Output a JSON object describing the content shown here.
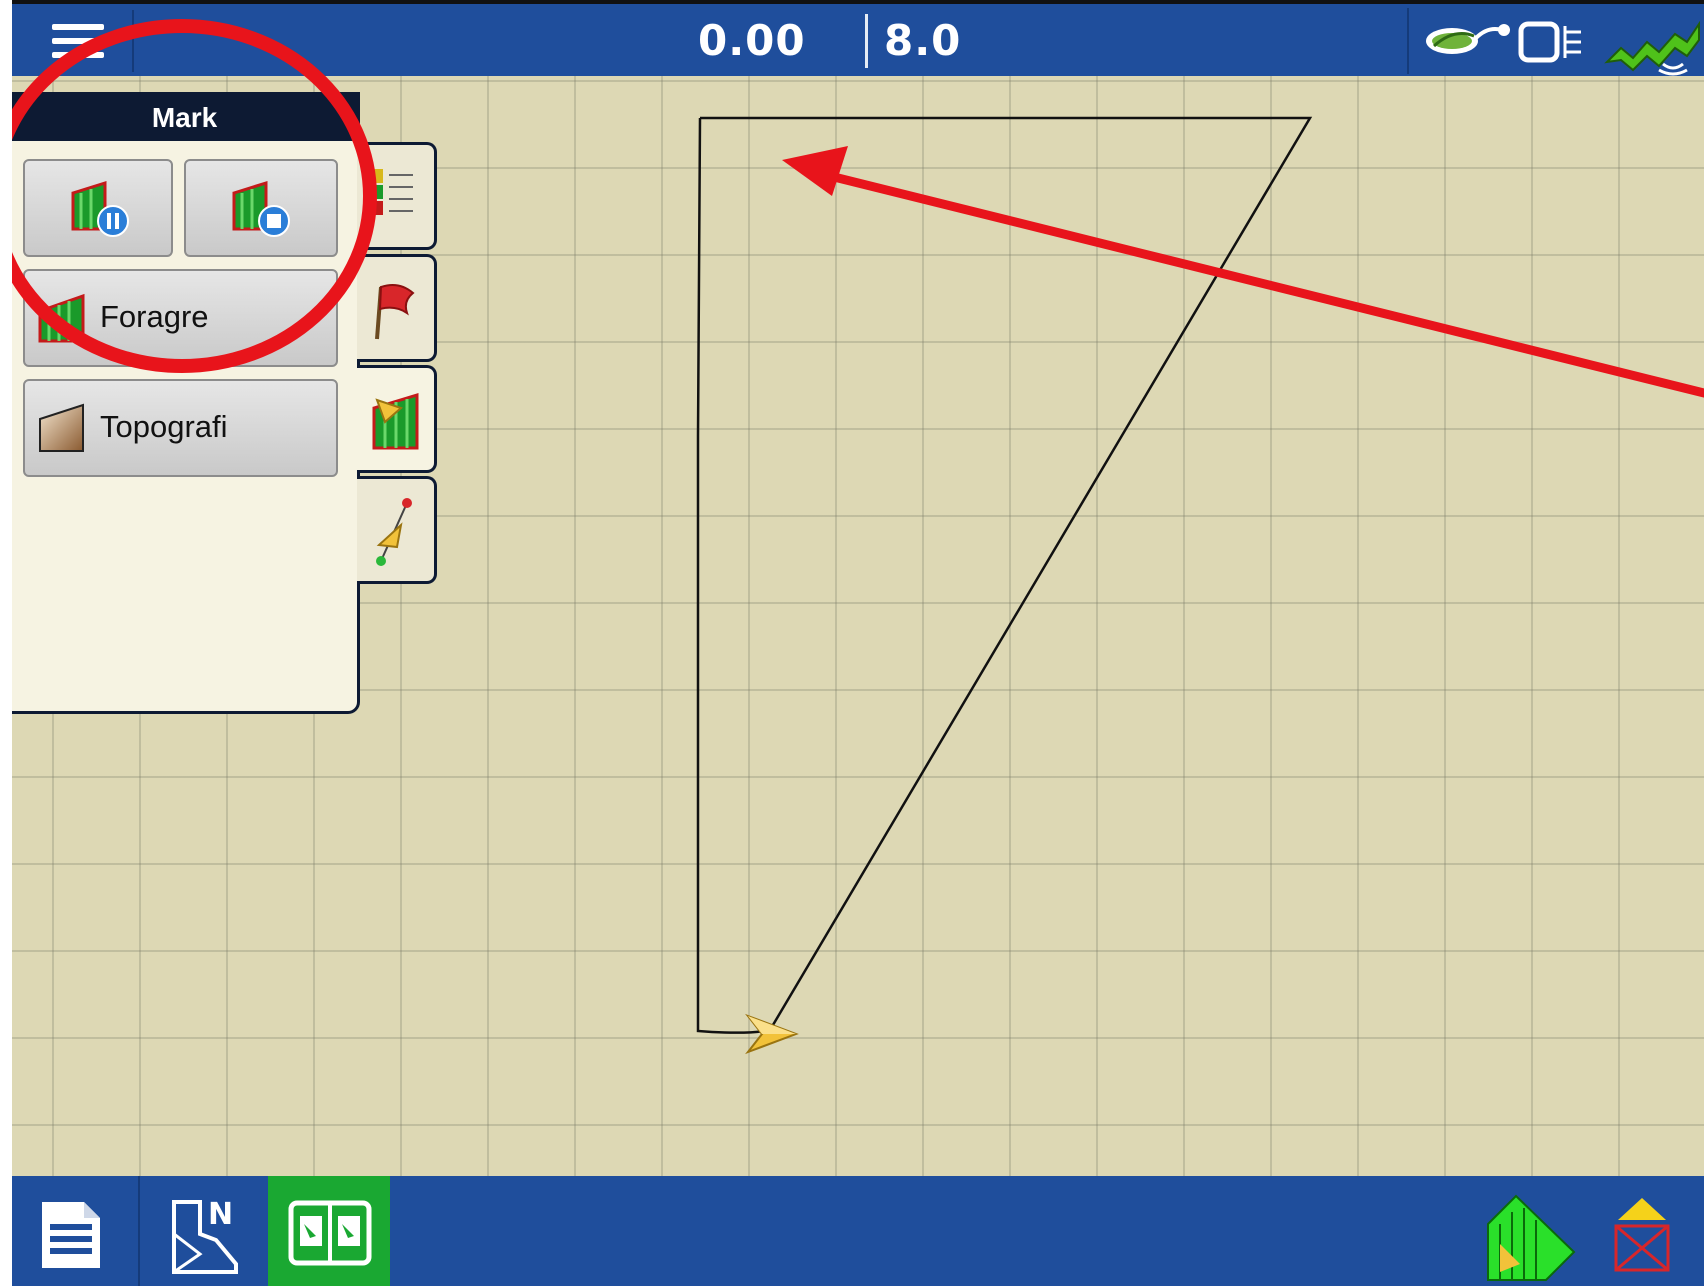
{
  "topbar": {
    "readout_left": "0.00",
    "readout_right": "8.0",
    "status_icons": [
      "gps-signal-icon",
      "display-icon",
      "cellular-modem-icon"
    ]
  },
  "mark_panel": {
    "title": "Mark",
    "buttons": [
      {
        "name": "pause-recording",
        "icon": "area-pause-icon"
      },
      {
        "name": "stop-recording",
        "icon": "area-stop-icon"
      },
      {
        "label": "Foragre",
        "icon": "forage-area-icon"
      },
      {
        "label": "Topografi",
        "icon": "topography-icon"
      }
    ]
  },
  "side_tabs": [
    {
      "name": "legend",
      "icon": "legend-icon"
    },
    {
      "name": "flags",
      "icon": "flag-icon"
    },
    {
      "name": "mark",
      "icon": "area-mark-icon",
      "active": true
    },
    {
      "name": "guidance",
      "icon": "guidance-line-icon"
    }
  ],
  "bottombar": {
    "left_buttons": [
      "report-icon",
      "field-map-icon",
      "split-map-icon"
    ],
    "right_buttons": [
      "coverage-mapping-icon",
      "alarm-icon"
    ],
    "active_button": "split-map-icon"
  },
  "annotations": {
    "highlight_color": "#e8141b",
    "arrow_color": "#e8141b"
  },
  "colors": {
    "bar": "#1f4e9c",
    "map": "#ddd8b4",
    "active": "#1aa832"
  }
}
